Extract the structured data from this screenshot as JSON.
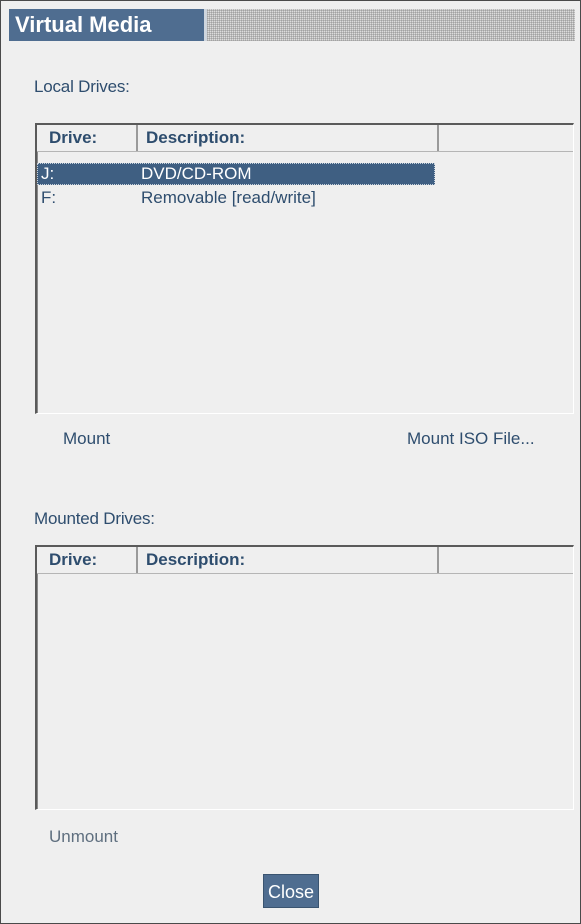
{
  "window": {
    "title": "Virtual Media"
  },
  "local": {
    "label": "Local Drives:",
    "columns": [
      "Drive:",
      "Description:",
      ""
    ],
    "rows": [
      {
        "drive": "J:",
        "description": "DVD/CD-ROM",
        "selected": true
      },
      {
        "drive": "F:",
        "description": "Removable [read/write]",
        "selected": false
      }
    ],
    "mount_label": "Mount",
    "mount_iso_label": "Mount ISO File..."
  },
  "mounted": {
    "label": "Mounted Drives:",
    "columns": [
      "Drive:",
      "Description:",
      ""
    ],
    "rows": [],
    "unmount_label": "Unmount"
  },
  "close_label": "Close"
}
